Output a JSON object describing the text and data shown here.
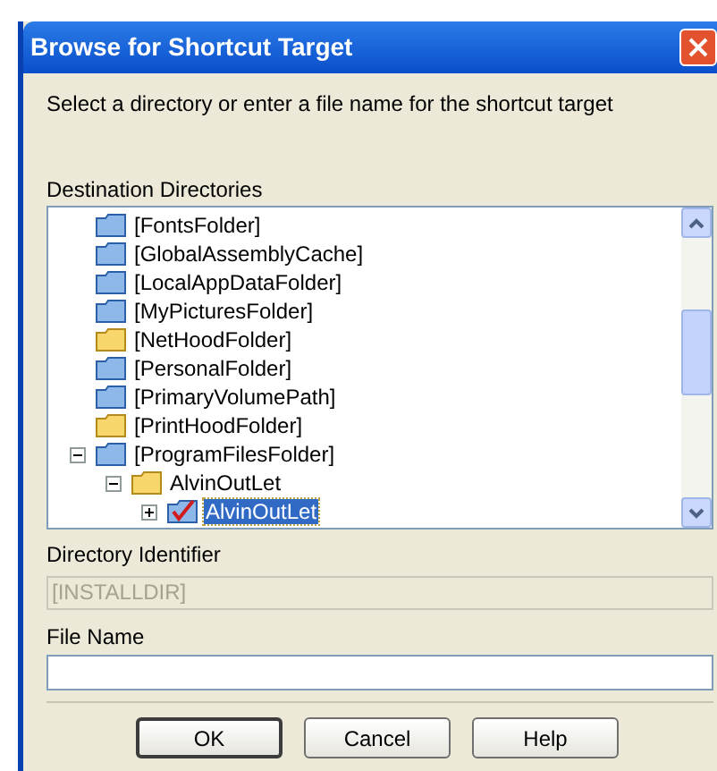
{
  "window": {
    "title": "Browse for Shortcut Target"
  },
  "instruction": "Select a directory or enter a file name for the shortcut target",
  "tree": {
    "label": "Destination Directories",
    "items": [
      {
        "label": "[FontsFolder]",
        "kind": "blue",
        "selected": false
      },
      {
        "label": "[GlobalAssemblyCache]",
        "kind": "blue",
        "selected": false
      },
      {
        "label": "[LocalAppDataFolder]",
        "kind": "blue",
        "selected": false
      },
      {
        "label": "[MyPicturesFolder]",
        "kind": "blue",
        "selected": false
      },
      {
        "label": "[NetHoodFolder]",
        "kind": "yellow",
        "selected": false
      },
      {
        "label": "[PersonalFolder]",
        "kind": "blue",
        "selected": false
      },
      {
        "label": "[PrimaryVolumePath]",
        "kind": "blue",
        "selected": false
      },
      {
        "label": "[PrintHoodFolder]",
        "kind": "yellow",
        "selected": false
      },
      {
        "label": "[ProgramFilesFolder]",
        "kind": "blue",
        "selected": false,
        "expanded": true,
        "children": [
          {
            "label": "AlvinOutLet",
            "kind": "yellow",
            "selected": false,
            "expanded": true,
            "children": [
              {
                "label": "AlvinOutLet",
                "kind": "checked",
                "selected": true,
                "expanded": false,
                "collapsed_children": true
              }
            ]
          }
        ]
      }
    ]
  },
  "directory_identifier": {
    "label": "Directory Identifier",
    "value": "[INSTALLDIR]",
    "disabled": true
  },
  "file_name": {
    "label": "File Name"
  },
  "buttons": [
    {
      "label": "OK",
      "default": true
    },
    {
      "label": "Cancel",
      "default": false
    },
    {
      "label": "Help",
      "default": false
    }
  ]
}
